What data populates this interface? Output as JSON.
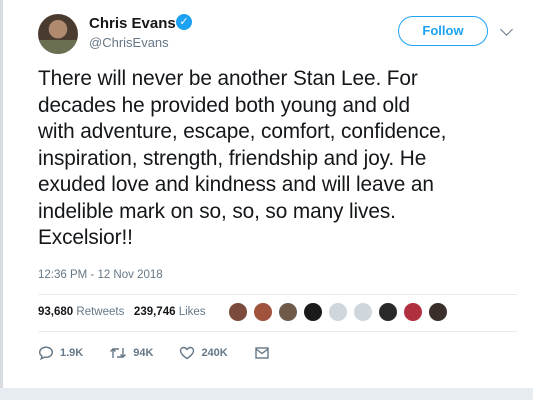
{
  "author": {
    "name": "Chris Evans",
    "handle": "@ChrisEvans",
    "verified_glyph": "✓"
  },
  "follow_label": "Follow",
  "tweet": {
    "text_lines": [
      "There will never be another Stan Lee. For",
      "decades he provided both young and old",
      "with adventure, escape, comfort, confidence,",
      "inspiration, strength, friendship and joy. He",
      "exuded love and kindness and will leave an",
      "indelible mark on so, so, so many lives.",
      "Excelsior!!"
    ],
    "timestamp": "12:36 PM - 12 Nov 2018"
  },
  "stats": {
    "retweets_count": "93,680",
    "retweets_label": "Retweets",
    "likes_count": "239,746",
    "likes_label": "Likes"
  },
  "likers_colors": [
    "#7a4a3a",
    "#a0523d",
    "#6f5a4a",
    "#1a1a1a",
    "#cfd6dc",
    "#cfd6dc",
    "#2a2a2a",
    "#b0303f",
    "#3a2f2a"
  ],
  "actions": {
    "reply_count": "1.9K",
    "retweet_count": "94K",
    "like_count": "240K"
  },
  "colors": {
    "accent": "#1da1f2",
    "secondary_text": "#657786"
  }
}
